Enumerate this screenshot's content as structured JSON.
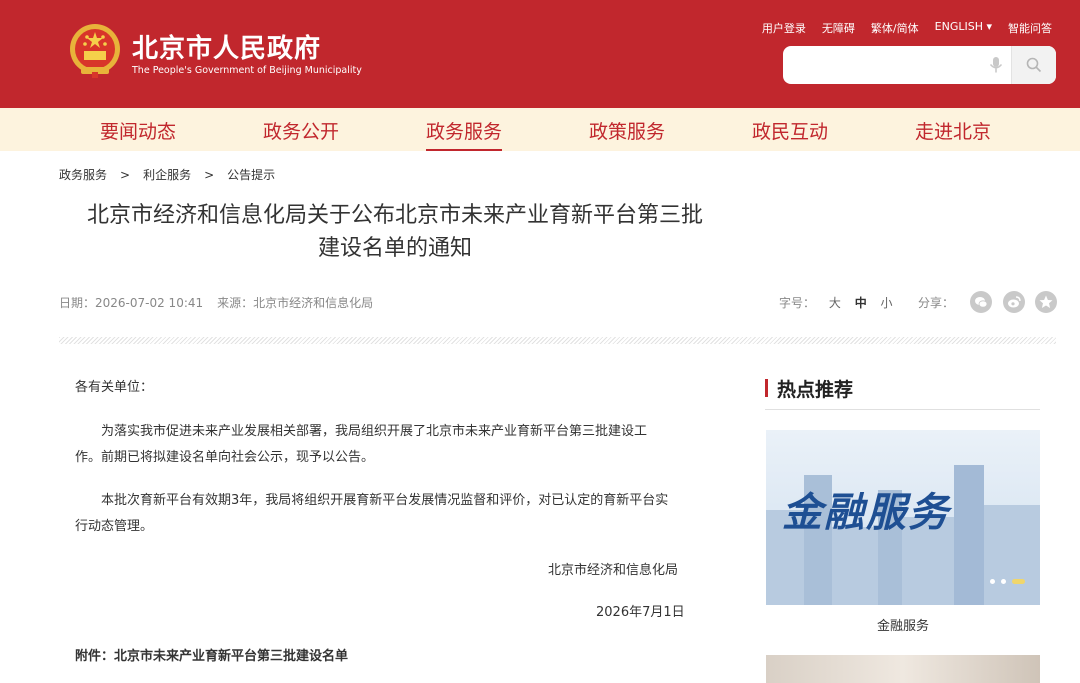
{
  "header": {
    "site_title": "北京市人民政府",
    "site_subtitle": "The People's Government of Beijing Municipality",
    "top_links": [
      "用户登录",
      "无障碍",
      "繁体/简体",
      "ENGLISH ▾",
      "智能问答"
    ],
    "search_placeholder": ""
  },
  "nav": {
    "items": [
      "要闻动态",
      "政务公开",
      "政务服务",
      "政策服务",
      "政民互动",
      "走进北京"
    ],
    "active": "政务服务"
  },
  "breadcrumb": [
    "政务服务",
    "利企服务",
    "公告提示"
  ],
  "breadcrumb_sep": ">",
  "article": {
    "title_line1": "北京市经济和信息化局关于公布北京市未来产业育新平台第三批",
    "title_line2": "建设名单的通知",
    "date": "日期：2026-07-02 10:41",
    "source": "来源：北京市经济和信息化局",
    "fontsize_label": "字号：",
    "fontsize_options": [
      "大",
      "中",
      "小"
    ],
    "share_label": "分享：",
    "greeting": "各有关单位：",
    "para1_line1": "为落实我市促进未来产业发展相关部署，我局组织开展了北京市未来产业育新平台第三批建设工",
    "para1_line2": "作。前期已将拟建设名单向社会公示，现予以公告。",
    "para2_line1": "本批次育新平台有效期3年，我局将组织开展育新平台发展情况监督和评价，对已认定的育新平台实",
    "para2_line2": "行动态管理。",
    "signature": "北京市经济和信息化局",
    "sign_date": "2026年7月1日",
    "attachment": "附件：北京市未来产业育新平台第三批建设名单"
  },
  "sidebar": {
    "title": "热点推荐",
    "banner_text": "金融服务",
    "banner_caption": "金融服务"
  },
  "colors": {
    "brand_red": "#c1272d",
    "nav_bg": "#fdf3de",
    "banner_blue": "#1e4f93"
  }
}
